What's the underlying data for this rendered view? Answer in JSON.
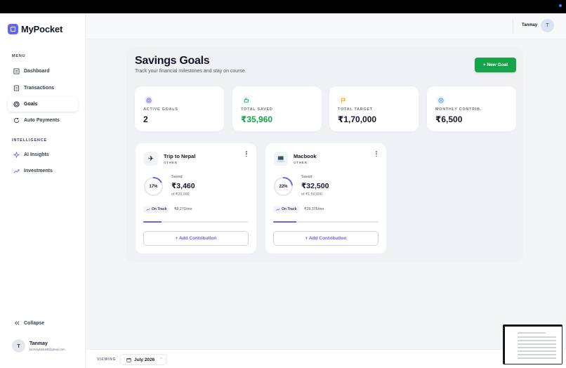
{
  "app": {
    "name": "MyPocket"
  },
  "sidebar": {
    "menu_label": "MENU",
    "menu_items": [
      {
        "label": "Dashboard",
        "icon": "dashboard-icon"
      },
      {
        "label": "Transactions",
        "icon": "transactions-icon"
      },
      {
        "label": "Goals",
        "icon": "goals-icon",
        "active": true
      },
      {
        "label": "Auto Payments",
        "icon": "auto-payments-icon"
      }
    ],
    "intelligence_label": "INTELLIGENCE",
    "intelligence_items": [
      {
        "label": "AI Insights",
        "icon": "sparkles-icon"
      },
      {
        "label": "Investments",
        "icon": "trending-up-icon"
      }
    ],
    "collapse_label": "Collapse",
    "user": {
      "initial": "T",
      "name": "Tanmay",
      "email": "tanmayksdu08@gmail.com"
    }
  },
  "header": {
    "user_name": "Tanmay",
    "avatar_initial": "T"
  },
  "page": {
    "title": "Savings Goals",
    "subtitle": "Track your financial milestones and stay on course.",
    "new_goal_label": "+ New Goal"
  },
  "stats": [
    {
      "label": "ACTIVE GOALS",
      "value": "2",
      "icon": "target-icon",
      "color": "#6366f1"
    },
    {
      "label": "TOTAL SAVED",
      "value": "₹35,960",
      "icon": "piggy-bank-icon",
      "color": "#16a34a"
    },
    {
      "label": "TOTAL TARGET",
      "value": "₹1,70,000",
      "icon": "flag-icon",
      "color": "#f59e0b"
    },
    {
      "label": "MONTHLY CONTRIB.",
      "value": "₹6,500",
      "icon": "plus-circle-icon",
      "color": "#3b82f6"
    }
  ],
  "goals": [
    {
      "name": "Trip to Nepal",
      "category": "OTHER",
      "icon": "airplane-icon",
      "glyph": "✈",
      "percent": 17,
      "percent_label": "17%",
      "saved_label": "Saved",
      "saved": "₹3,460",
      "target_text": "of ₹20,000",
      "status": "On Track",
      "rate": "₹8,270/mo",
      "add_label": "+ Add Contribution"
    },
    {
      "name": "Macbook",
      "category": "OTHER",
      "icon": "laptop-icon",
      "glyph": "💻",
      "percent": 22,
      "percent_label": "22%",
      "saved_label": "Saved",
      "saved": "₹32,500",
      "target_text": "of ₹1,50,000",
      "status": "On Track",
      "rate": "₹29,375/mo",
      "add_label": "+ Add Contribution"
    }
  ],
  "footer": {
    "viewing_label": "VIEWING",
    "month": "July 2026"
  },
  "colors": {
    "accent": "#6366f1",
    "success": "#16a34a"
  }
}
